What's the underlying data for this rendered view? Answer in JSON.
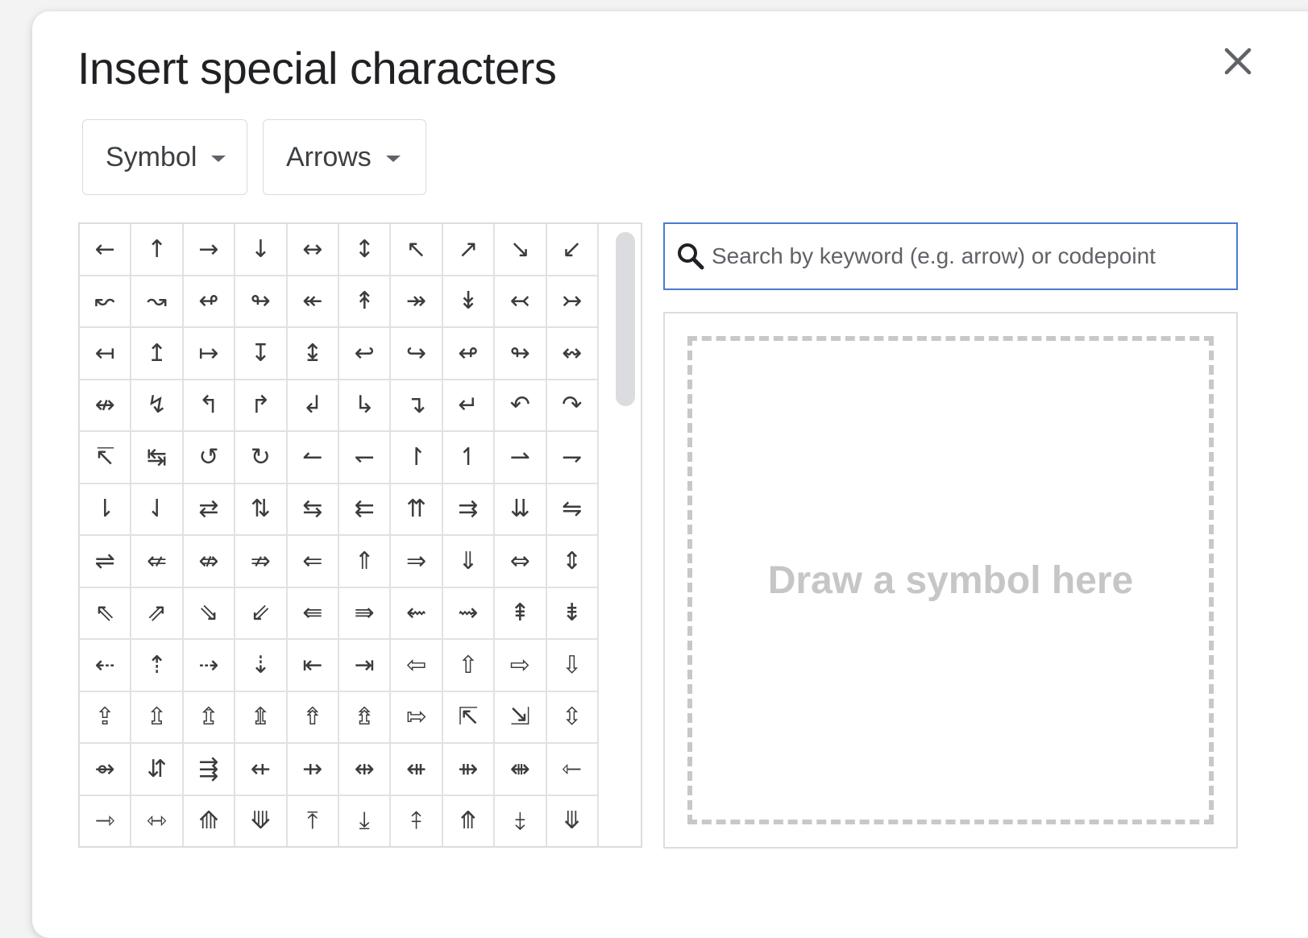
{
  "dialog": {
    "title": "Insert special characters",
    "close_icon": "close-icon"
  },
  "filters": {
    "category": "Symbol",
    "subcategory": "Arrows"
  },
  "grid": {
    "characters": [
      [
        "←",
        "↑",
        "→",
        "↓",
        "↔",
        "↕",
        "↖",
        "↗",
        "↘",
        "↙"
      ],
      [
        "↜",
        "↝",
        "↫",
        "↬",
        "↞",
        "↟",
        "↠",
        "↡",
        "↢",
        "↣"
      ],
      [
        "↤",
        "↥",
        "↦",
        "↧",
        "↨",
        "↩",
        "↪",
        "↫",
        "↬",
        "↭"
      ],
      [
        "↮",
        "↯",
        "↰",
        "↱",
        "↲",
        "↳",
        "↴",
        "↵",
        "↶",
        "↷"
      ],
      [
        "↸",
        "↹",
        "↺",
        "↻",
        "↼",
        "↽",
        "↾",
        "↿",
        "⇀",
        "⇁"
      ],
      [
        "⇂",
        "⇃",
        "⇄",
        "⇅",
        "⇆",
        "⇇",
        "⇈",
        "⇉",
        "⇊",
        "⇋"
      ],
      [
        "⇌",
        "⇍",
        "⇎",
        "⇏",
        "⇐",
        "⇑",
        "⇒",
        "⇓",
        "⇔",
        "⇕"
      ],
      [
        "⇖",
        "⇗",
        "⇘",
        "⇙",
        "⇚",
        "⇛",
        "⇜",
        "⇝",
        "⇞",
        "⇟"
      ],
      [
        "⇠",
        "⇡",
        "⇢",
        "⇣",
        "⇤",
        "⇥",
        "⇦",
        "⇧",
        "⇨",
        "⇩"
      ],
      [
        "⇪",
        "⇫",
        "⇬",
        "⇭",
        "⇮",
        "⇯",
        "⇰",
        "⇱",
        "⇲",
        "⇳"
      ],
      [
        "⇴",
        "⇵",
        "⇶",
        "⇷",
        "⇸",
        "⇹",
        "⇺",
        "⇻",
        "⇼",
        "⇽"
      ],
      [
        "⇾",
        "⇿",
        "⟰",
        "⟱",
        "⤒",
        "⤓",
        "⤉",
        "⤊",
        "⤈",
        "⤋"
      ]
    ]
  },
  "search": {
    "placeholder": "Search by keyword (e.g. arrow) or codepoint",
    "value": "",
    "icon": "search-icon"
  },
  "draw": {
    "hint": "Draw a symbol here"
  }
}
